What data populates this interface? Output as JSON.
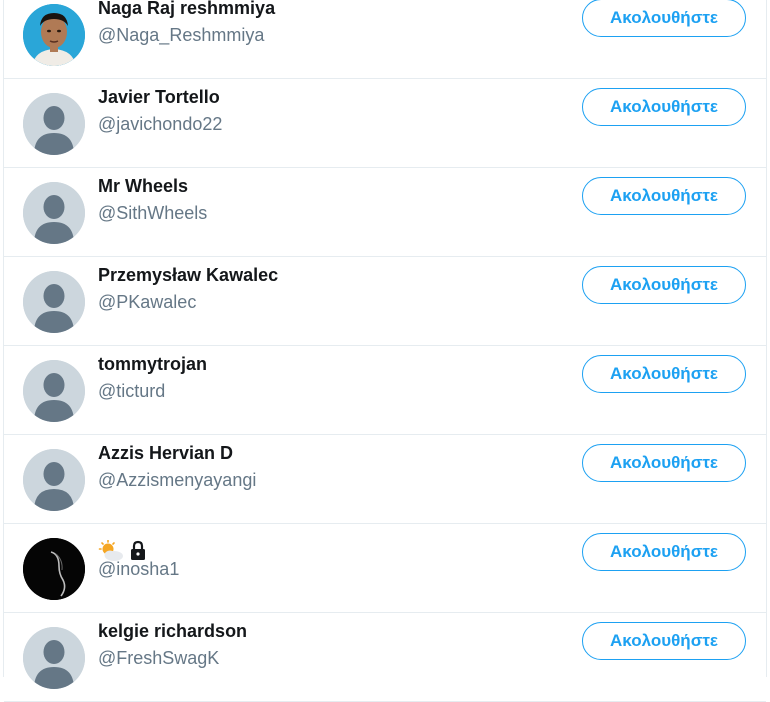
{
  "follow_label": "Ακολουθήστε",
  "users": [
    {
      "name": "Naga Raj reshmmiya",
      "handle": "@Naga_Reshmmiya",
      "avatar": "photo-face-icon"
    },
    {
      "name": "Javier Tortello",
      "handle": "@javichondo22",
      "avatar": "default-avatar-icon"
    },
    {
      "name": "Mr Wheels",
      "handle": "@SithWheels",
      "avatar": "default-avatar-icon"
    },
    {
      "name": "Przemysław Kawalec",
      "handle": "@PKawalec",
      "avatar": "default-avatar-icon"
    },
    {
      "name": "tommytrojan",
      "handle": "@ticturd",
      "avatar": "default-avatar-icon"
    },
    {
      "name": "Azzis Hervian D",
      "handle": "@Azzismenyayangi",
      "avatar": "default-avatar-icon"
    },
    {
      "name": "",
      "handle": "@inosha1",
      "avatar": "dark-silhouette-icon",
      "name_icons": [
        "sun-behind-cloud-icon",
        "lock-icon"
      ]
    },
    {
      "name": "kelgie richardson",
      "handle": "@FreshSwagK",
      "avatar": "default-avatar-icon"
    }
  ],
  "colors": {
    "accent": "#1da1f2",
    "name": "#14171a",
    "handle": "#657786",
    "divider": "#e6ecf0",
    "avatar_bg": "#ccd6dd",
    "avatar_fg": "#657786"
  }
}
